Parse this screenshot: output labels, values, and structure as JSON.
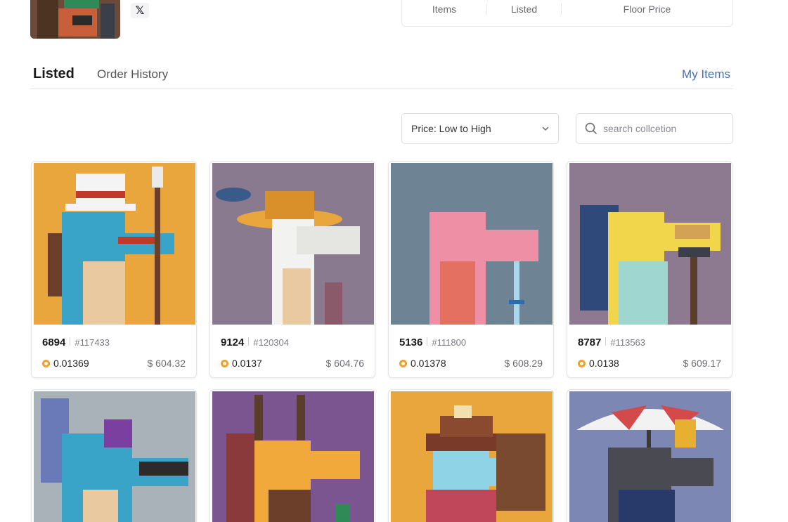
{
  "header": {
    "avatar_alt": "collection avatar",
    "social_icon": "x-icon",
    "social_glyph": "𝕏"
  },
  "stats": {
    "items_label": "Items",
    "listed_label": "Listed",
    "floor_label": "Floor Price"
  },
  "tabs": {
    "listed": "Listed",
    "order_history": "Order History",
    "my_items": "My Items"
  },
  "controls": {
    "sort_value": "Price: Low to High",
    "search_placeholder": "search collcetion"
  },
  "cards": [
    {
      "name": "6894",
      "id": "#117433",
      "price": "0.01369",
      "usd": "$ 604.32",
      "bg": "#e9a63c"
    },
    {
      "name": "9124",
      "id": "#120304",
      "price": "0.0137",
      "usd": "$ 604.76",
      "bg": "#8a7a90"
    },
    {
      "name": "5136",
      "id": "#111800",
      "price": "0.01378",
      "usd": "$ 608.29",
      "bg": "#6e8393"
    },
    {
      "name": "8787",
      "id": "#113563",
      "price": "0.0138",
      "usd": "$ 609.17",
      "bg": "#8e7a90"
    },
    {
      "bg": "#a9b2b8"
    },
    {
      "bg": "#7a5590"
    },
    {
      "bg": "#e9a63c"
    },
    {
      "bg": "#7d87b4"
    }
  ],
  "colors": {
    "accent": "#4a6fae",
    "coin": "#e8a23a"
  }
}
